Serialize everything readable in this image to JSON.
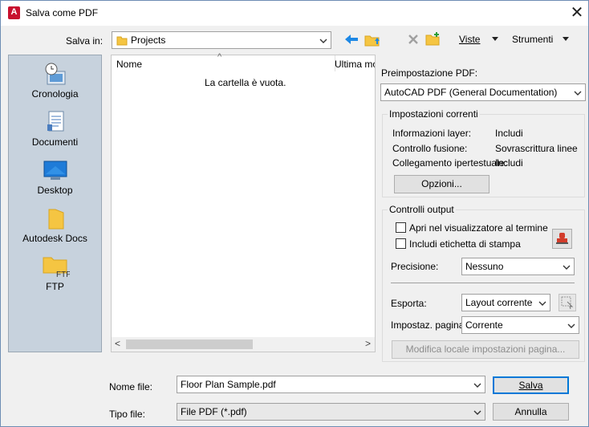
{
  "window": {
    "title": "Salva come PDF",
    "icon_letter": "A",
    "close_glyph": "✕"
  },
  "toolbar": {
    "save_in_label": "Salva in:",
    "location": "Projects",
    "views_label": "Viste",
    "tools_label": "Strumenti",
    "icons": [
      "back-arrow-icon",
      "up-folder-icon",
      "delete-icon",
      "new-folder-icon"
    ]
  },
  "places": [
    {
      "label": "Cronologia",
      "icon": "history-icon"
    },
    {
      "label": "Documenti",
      "icon": "documents-icon"
    },
    {
      "label": "Desktop",
      "icon": "desktop-icon"
    },
    {
      "label": "Autodesk Docs",
      "icon": "autodesk-docs-icon"
    },
    {
      "label": "FTP",
      "icon": "ftp-icon",
      "icon_text": "FTP"
    }
  ],
  "filelist": {
    "columns": [
      "Nome",
      "Ultima mo"
    ],
    "sort_glyph": "^",
    "empty_message": "La cartella è vuota.",
    "scroll_left": "<",
    "scroll_right": ">"
  },
  "pdf": {
    "preset_label": "Preimpostazione PDF:",
    "preset_value": "AutoCAD PDF (General Documentation)",
    "current_settings_title": "Impostazioni correnti",
    "settings": [
      {
        "label": "Informazioni layer:",
        "value": "Includi"
      },
      {
        "label": "Controllo fusione:",
        "value": "Sovrascrittura linee"
      },
      {
        "label": "Collegamento ipertestuale:",
        "value": "Includi"
      }
    ],
    "options_button": "Opzioni...",
    "output_title": "Controlli output",
    "open_viewer_label": "Apri nel visualizzatore al termine",
    "open_viewer_checked": false,
    "include_stamp_label": "Includi etichetta di stampa",
    "include_stamp_checked": false,
    "precision_label": "Precisione:",
    "precision_value": "Nessuno",
    "export_label": "Esporta:",
    "export_value": "Layout corrente",
    "page_setup_label": "Impostaz. pagina:",
    "page_setup_value": "Corrente",
    "modify_page_button": "Modifica locale impostazioni pagina..."
  },
  "bottom": {
    "filename_label": "Nome file:",
    "filename_value": "Floor Plan Sample.pdf",
    "filetype_label": "Tipo file:",
    "filetype_value": "File PDF (*.pdf)",
    "save_button": "Salva",
    "cancel_button": "Annulla"
  },
  "colors": {
    "accent": "#0078d7",
    "places_bg": "#c7d2dd",
    "autocad_red": "#c8102e",
    "folder_yellow": "#f5c542"
  }
}
